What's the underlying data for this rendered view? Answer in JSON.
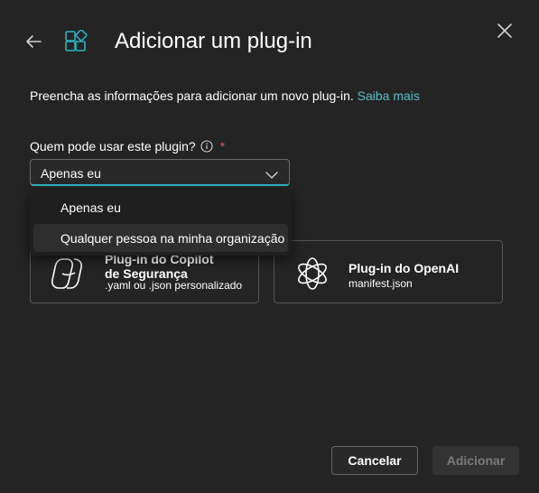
{
  "dialog": {
    "title": "Adicionar um plug-in",
    "description": "Preencha as informações para adicionar um novo plug-in.",
    "learn_more": "Saiba mais"
  },
  "who_can_use": {
    "label": "Quem pode usar este plugin?",
    "required_mark": "*",
    "selected": "Apenas eu",
    "options": [
      "Apenas eu",
      "Qualquer pessoa na minha organização"
    ]
  },
  "cards": [
    {
      "title_line1": "Plug-in do Copilot",
      "title_line2": "de Segurança",
      "subtitle": ".yaml ou .json personalizado",
      "icon": "copilot-icon"
    },
    {
      "title_line1": "Plug-in do OpenAI",
      "subtitle": "manifest.json",
      "icon": "openai-icon"
    }
  ],
  "buttons": {
    "cancel": "Cancelar",
    "add": "Adicionar"
  },
  "colors": {
    "background": "#242424",
    "accent": "#2db3c0",
    "link": "#5bbcc7",
    "required": "#e05a5a"
  }
}
